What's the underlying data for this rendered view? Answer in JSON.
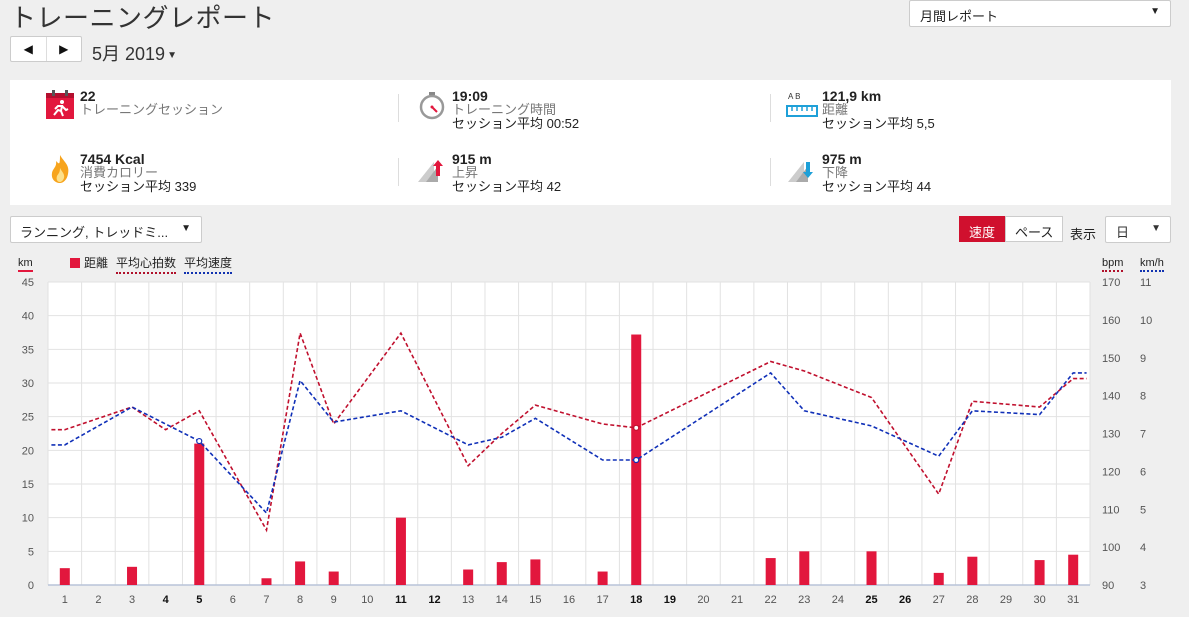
{
  "header": {
    "title": "トレーニングレポート",
    "report_type": "月間レポート",
    "period": "5月 2019",
    "prev_label": "◀",
    "next_label": "▶"
  },
  "summary": {
    "sessions": {
      "value": "22",
      "label": "トレーニングセッション"
    },
    "time": {
      "value": "19:09",
      "label": "トレーニング時間",
      "avg": "セッション平均 00:52"
    },
    "distance": {
      "value": "121,9 km",
      "label": "距離",
      "avg": "セッション平均 5,5"
    },
    "calories": {
      "value": "7454 Kcal",
      "label": "消費カロリー",
      "avg": "セッション平均 339"
    },
    "ascent": {
      "value": "915 m",
      "label": "上昇",
      "avg": "セッション平均 42"
    },
    "descent": {
      "value": "975 m",
      "label": "下降",
      "avg": "セッション平均 44"
    },
    "distance_icon_text": "A B"
  },
  "controls": {
    "activity": "ランニング, トレッドミ...",
    "speed": "速度",
    "pace": "ペース",
    "show": "表示",
    "period": "日"
  },
  "legend": {
    "distance": "距離",
    "avg_hr": "平均心拍数",
    "avg_speed": "平均速度",
    "unit_km": "km",
    "unit_bpm": "bpm",
    "unit_kmh": "km/h"
  },
  "colors": {
    "bar": "#e2173d",
    "hr": "#c0102e",
    "speed": "#1030b8",
    "accent": "#d0102e"
  },
  "chart_data": {
    "type": "bar",
    "days": [
      1,
      2,
      3,
      4,
      5,
      6,
      7,
      8,
      9,
      10,
      11,
      12,
      13,
      14,
      15,
      16,
      17,
      18,
      19,
      20,
      21,
      22,
      23,
      24,
      25,
      26,
      27,
      28,
      29,
      30,
      31
    ],
    "bold_days": [
      4,
      5,
      11,
      12,
      18,
      19,
      25,
      26
    ],
    "left_axis": {
      "label": "km",
      "ticks": [
        0,
        5,
        10,
        15,
        20,
        25,
        30,
        35,
        40,
        45
      ],
      "ylim": [
        0,
        45
      ]
    },
    "hr_axis": {
      "label": "bpm",
      "ticks": [
        90,
        100,
        110,
        120,
        130,
        140,
        150,
        160,
        170
      ],
      "ylim": [
        90,
        170
      ]
    },
    "speed_axis": {
      "label": "km/h",
      "ticks": [
        3,
        4,
        5,
        6,
        7,
        8,
        9,
        10,
        11
      ],
      "ylim": [
        3,
        11
      ]
    },
    "series": [
      {
        "name": "距離",
        "kind": "bar",
        "points": [
          [
            1,
            2.5
          ],
          [
            3,
            2.7
          ],
          [
            5,
            21
          ],
          [
            7,
            1
          ],
          [
            8,
            3.5
          ],
          [
            9,
            2
          ],
          [
            11,
            10
          ],
          [
            13,
            2.3
          ],
          [
            14,
            3.4
          ],
          [
            15,
            3.8
          ],
          [
            17,
            2
          ],
          [
            18,
            37.2
          ],
          [
            22,
            4
          ],
          [
            23,
            5
          ],
          [
            25,
            5
          ],
          [
            27,
            1.8
          ],
          [
            28,
            4.2
          ],
          [
            30,
            3.7
          ],
          [
            31,
            4.5
          ]
        ]
      },
      {
        "name": "平均心拍数",
        "kind": "line",
        "points": [
          [
            1,
            131
          ],
          [
            3,
            137
          ],
          [
            4,
            131
          ],
          [
            5,
            136
          ],
          [
            7,
            104.5
          ],
          [
            8,
            156.5
          ],
          [
            9,
            132.5
          ],
          [
            11,
            156.5
          ],
          [
            13,
            121.5
          ],
          [
            14,
            130
          ],
          [
            15,
            137.5
          ],
          [
            17,
            132.5
          ],
          [
            18,
            131.5
          ],
          [
            22,
            149
          ],
          [
            23,
            146.5
          ],
          [
            25,
            139.5
          ],
          [
            27,
            114
          ],
          [
            28,
            138.5
          ],
          [
            30,
            137
          ],
          [
            31,
            144.5
          ]
        ]
      },
      {
        "name": "平均速度",
        "kind": "line",
        "points": [
          [
            1,
            6.7
          ],
          [
            3,
            7.7
          ],
          [
            5,
            6.8
          ],
          [
            7,
            4.9
          ],
          [
            8,
            8.4
          ],
          [
            9,
            7.3
          ],
          [
            11,
            7.6
          ],
          [
            13,
            6.7
          ],
          [
            14,
            6.9
          ],
          [
            15,
            7.4
          ],
          [
            17,
            6.3
          ],
          [
            18,
            6.3
          ],
          [
            22,
            8.6
          ],
          [
            23,
            7.6
          ],
          [
            25,
            7.2
          ],
          [
            27,
            6.4
          ],
          [
            28,
            7.6
          ],
          [
            30,
            7.5
          ],
          [
            31,
            8.6
          ]
        ]
      }
    ]
  }
}
